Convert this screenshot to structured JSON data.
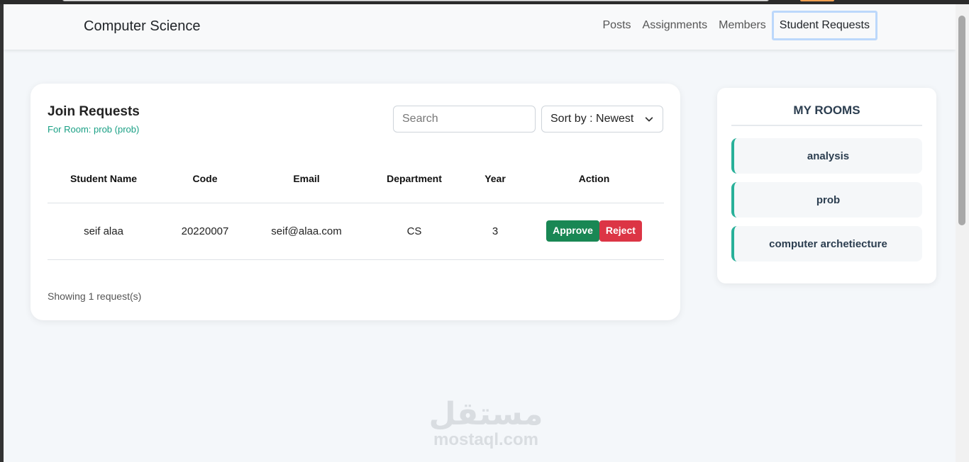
{
  "navbar": {
    "brand": "Computer Science",
    "links": [
      "Posts",
      "Assignments",
      "Members",
      "Student Requests"
    ],
    "active": "Student Requests"
  },
  "requests": {
    "title": "Join Requests",
    "subtitle": "For Room: prob (prob)",
    "search_placeholder": "Search",
    "sort_label": "Sort by : Newest",
    "columns": [
      "Student Name",
      "Code",
      "Email",
      "Department",
      "Year",
      "Action"
    ],
    "rows": [
      {
        "name": "seif alaa",
        "code": "20220007",
        "email": "seif@alaa.com",
        "department": "CS",
        "year": "3"
      }
    ],
    "approve_label": "Approve",
    "reject_label": "Reject",
    "footer": "Showing 1 request(s)"
  },
  "rooms": {
    "title": "MY ROOMS",
    "items": [
      "analysis",
      "prob",
      "computer archetiecture"
    ]
  },
  "watermark": {
    "arabic": "مستقل",
    "latin": "mostaql.com"
  },
  "colors": {
    "accent": "#1aa085",
    "approve": "#198754",
    "reject": "#dc3545",
    "room_border": "#28b099"
  }
}
